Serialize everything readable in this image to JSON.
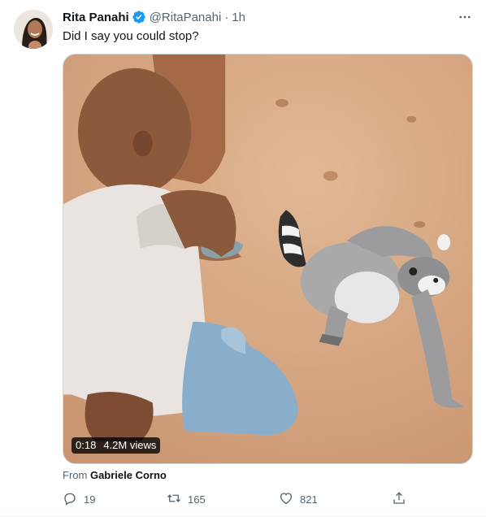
{
  "tweet": {
    "author_name": "Rita Panahi",
    "handle": "@RitaPanahi",
    "separator": "·",
    "time": "1h",
    "text": "Did I say you could stop?",
    "video": {
      "duration": "0:18",
      "views": "4.2M views"
    },
    "from_prefix": "From",
    "from_name": "Gabriele Corno",
    "actions": {
      "replies": "19",
      "retweets": "165",
      "likes": "821"
    }
  },
  "icons": {
    "verified": "verified-badge-icon",
    "more": "more-dots-icon",
    "reply": "reply-icon",
    "retweet": "retweet-icon",
    "like": "heart-icon",
    "share": "share-icon"
  },
  "colors": {
    "verified_blue": "#1d9bf0",
    "secondary_text": "#536471",
    "primary_text": "#0f1419"
  }
}
